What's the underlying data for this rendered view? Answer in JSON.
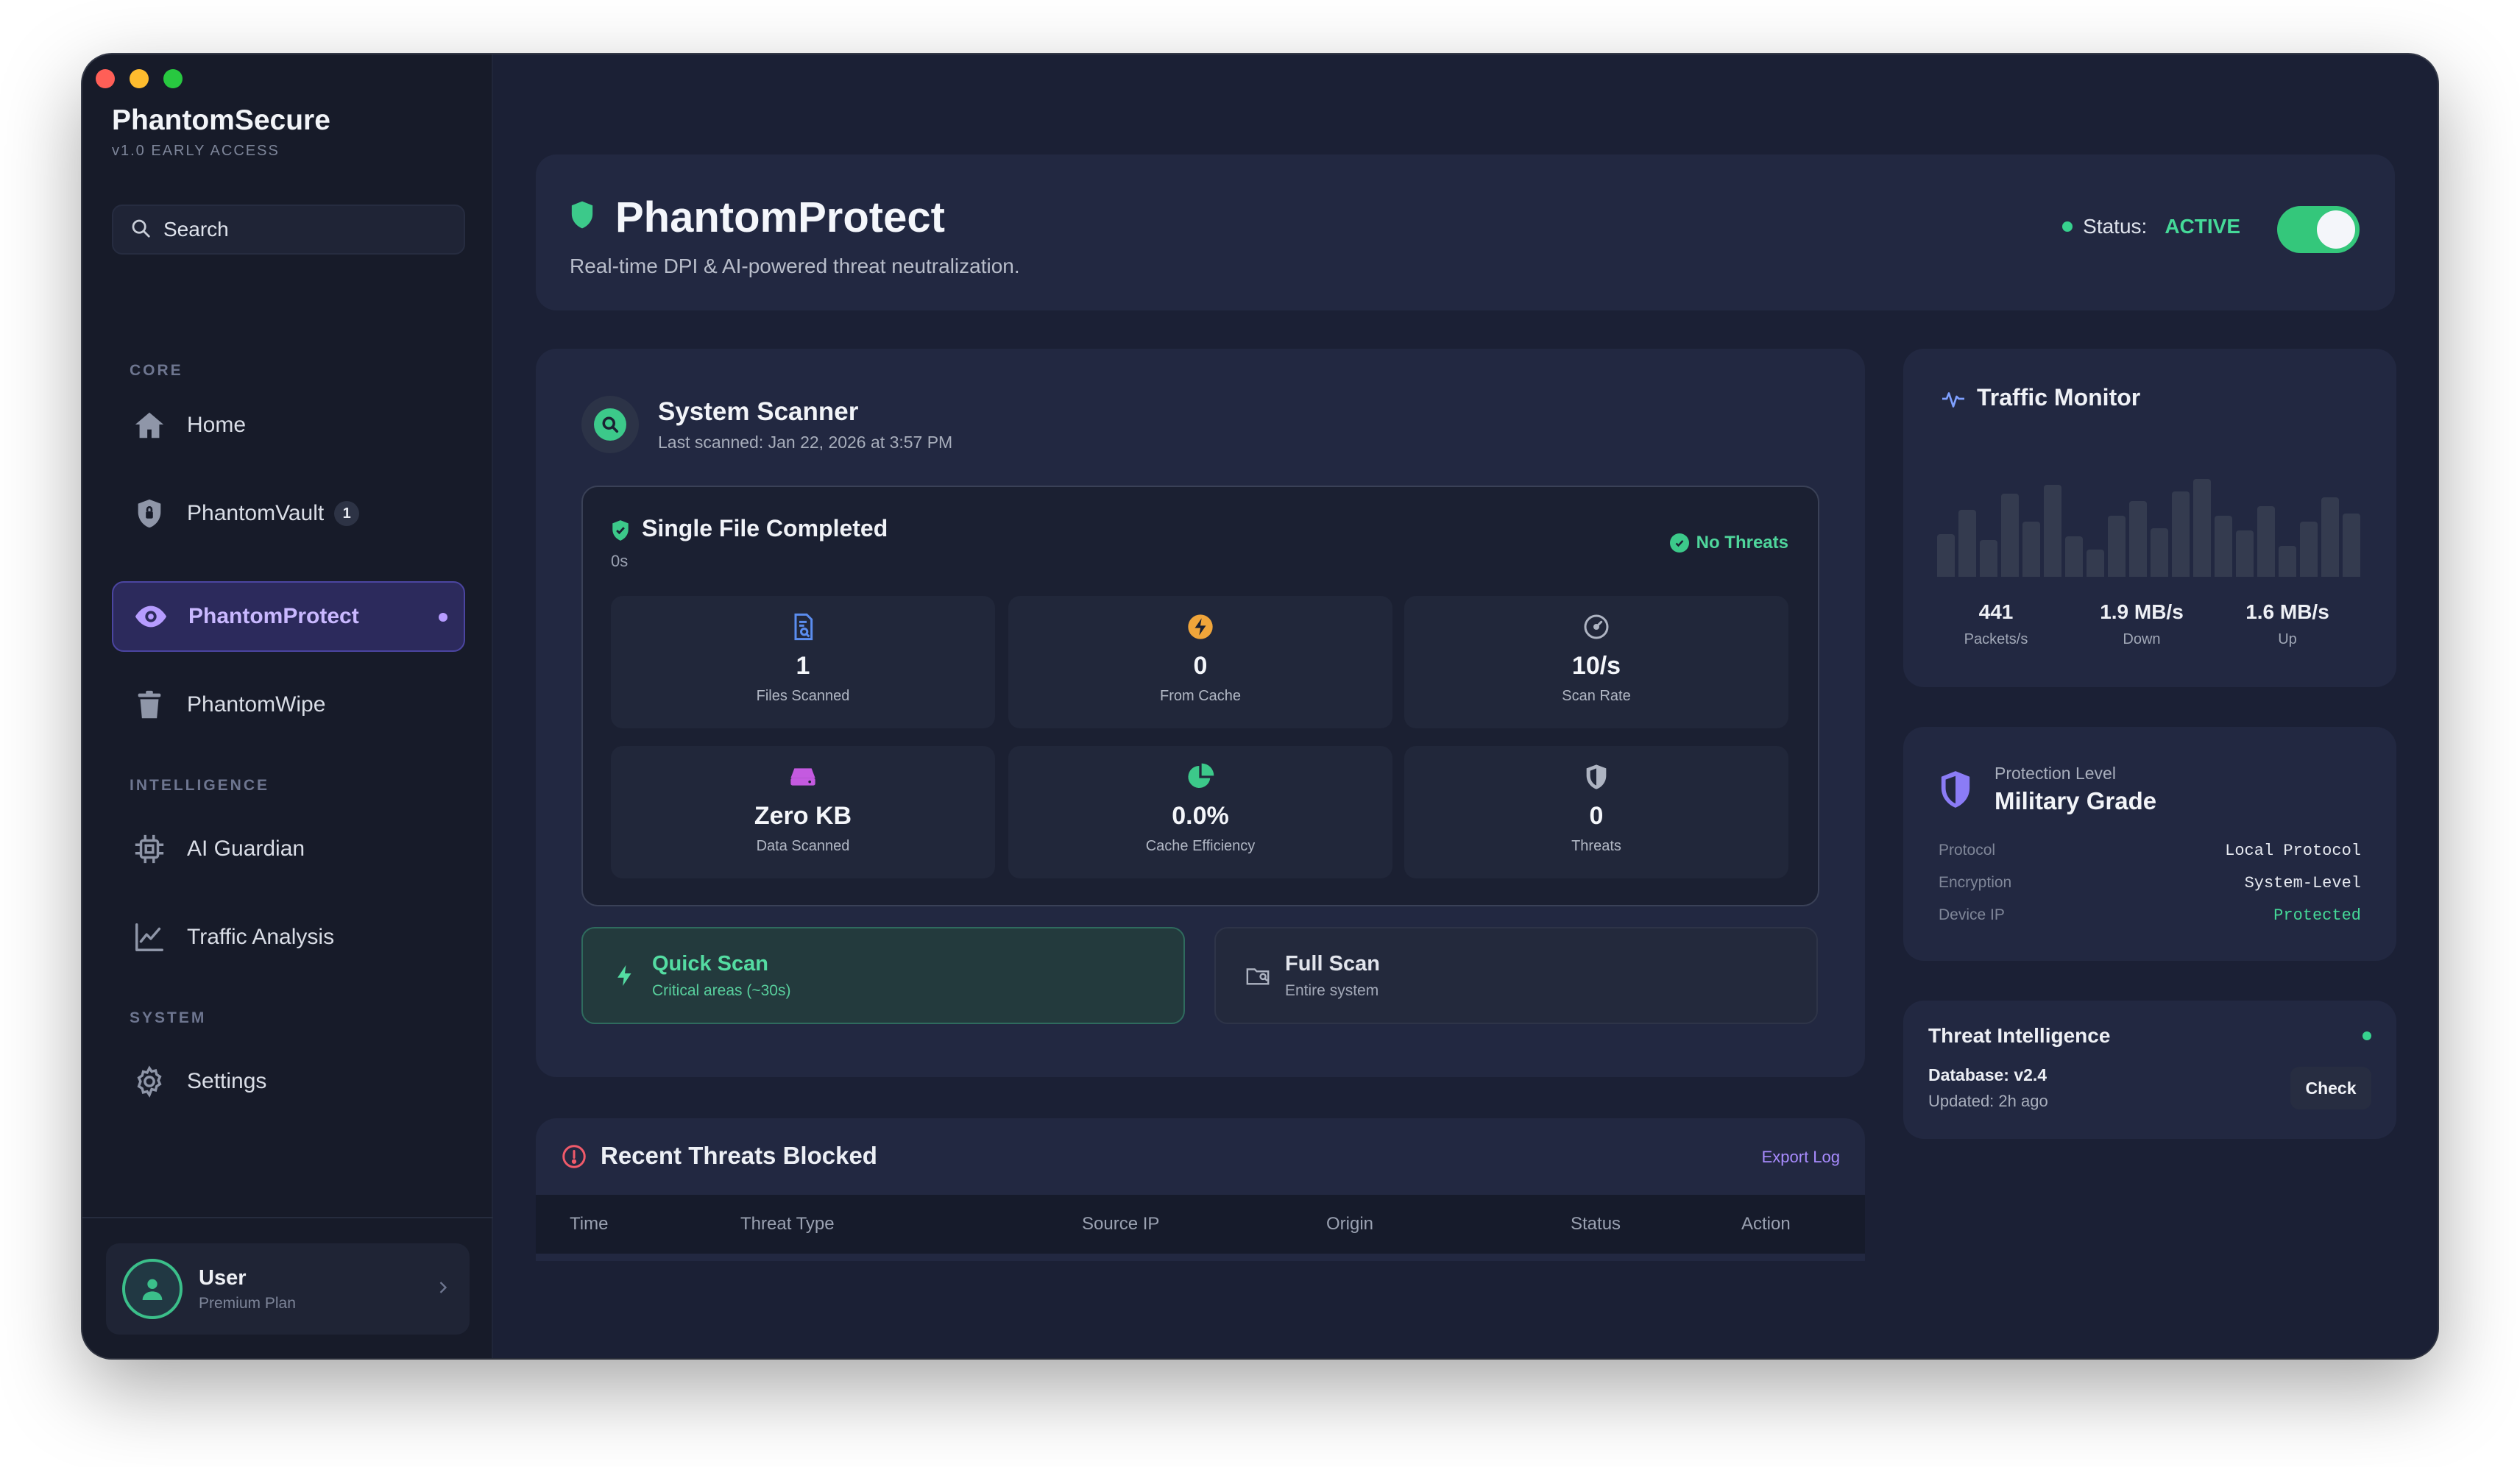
{
  "app": {
    "brand": "PhantomSecure",
    "version": "v1.0 EARLY ACCESS"
  },
  "search": {
    "placeholder": "Search"
  },
  "sidebar": {
    "sections": [
      "CORE",
      "INTELLIGENCE",
      "SYSTEM"
    ],
    "items": [
      {
        "label": "Home",
        "icon": "home-icon"
      },
      {
        "label": "PhantomVault",
        "icon": "lock-shield-icon",
        "badge": "1"
      },
      {
        "label": "PhantomProtect",
        "icon": "eye-icon",
        "active": true
      },
      {
        "label": "PhantomWipe",
        "icon": "trash-icon"
      },
      {
        "label": "AI Guardian",
        "icon": "chip-icon"
      },
      {
        "label": "Traffic Analysis",
        "icon": "line-chart-icon"
      },
      {
        "label": "Settings",
        "icon": "gear-icon"
      }
    ]
  },
  "user": {
    "name": "User",
    "plan": "Premium Plan"
  },
  "header": {
    "title": "PhantomProtect",
    "subtitle": "Real-time DPI & AI-powered threat neutralization.",
    "status_label": "Status:",
    "status_value": "ACTIVE",
    "toggle_on": true
  },
  "scanner": {
    "title": "System Scanner",
    "last_scanned": "Last scanned: Jan 22, 2026 at 3:57 PM",
    "result": {
      "title": "Single File Completed",
      "duration": "0s",
      "badge": "No Threats"
    },
    "stats": [
      {
        "value": "1",
        "label": "Files Scanned",
        "icon": "document-search-icon",
        "color": "#5b8def"
      },
      {
        "value": "0",
        "label": "From Cache",
        "icon": "lightning-icon",
        "color": "#f0a53a"
      },
      {
        "value": "10/s",
        "label": "Scan Rate",
        "icon": "speedometer-icon",
        "color": "#aeb4c2"
      },
      {
        "value": "Zero KB",
        "label": "Data Scanned",
        "icon": "hard-drive-icon",
        "color": "#c45ae0"
      },
      {
        "value": "0.0%",
        "label": "Cache Efficiency",
        "icon": "pie-chart-icon",
        "color": "#3cc98a"
      },
      {
        "value": "0",
        "label": "Threats",
        "icon": "shield-icon",
        "color": "#aeb4c2"
      }
    ],
    "quick_scan": {
      "title": "Quick Scan",
      "subtitle": "Critical areas (~30s)"
    },
    "full_scan": {
      "title": "Full Scan",
      "subtitle": "Entire system"
    }
  },
  "threats": {
    "title": "Recent Threats Blocked",
    "export": "Export Log",
    "columns": [
      "Time",
      "Threat Type",
      "Source IP",
      "Origin",
      "Status",
      "Action"
    ]
  },
  "traffic": {
    "title": "Traffic Monitor",
    "bar_levels": [
      0.35,
      0.55,
      0.3,
      0.68,
      0.45,
      0.75,
      0.33,
      0.22,
      0.5,
      0.62,
      0.4,
      0.7,
      0.8,
      0.5,
      0.38,
      0.58,
      0.25,
      0.45,
      0.65,
      0.52
    ],
    "stats": [
      {
        "value": "441",
        "label": "Packets/s"
      },
      {
        "value": "1.9 MB/s",
        "label": "Down"
      },
      {
        "value": "1.6 MB/s",
        "label": "Up"
      }
    ]
  },
  "protection": {
    "label": "Protection Level",
    "value": "Military Grade",
    "rows": [
      {
        "key": "Protocol",
        "value": "Local Protocol"
      },
      {
        "key": "Encryption",
        "value": "System-Level"
      },
      {
        "key": "Device IP",
        "value": "Protected"
      }
    ]
  },
  "intel": {
    "title": "Threat Intelligence",
    "database": "Database: v2.4",
    "updated": "Updated: 2h ago",
    "check": "Check"
  },
  "colors": {
    "accent_green": "#3cc98a",
    "accent_purple": "#a98cff",
    "background": "#1b2035"
  }
}
